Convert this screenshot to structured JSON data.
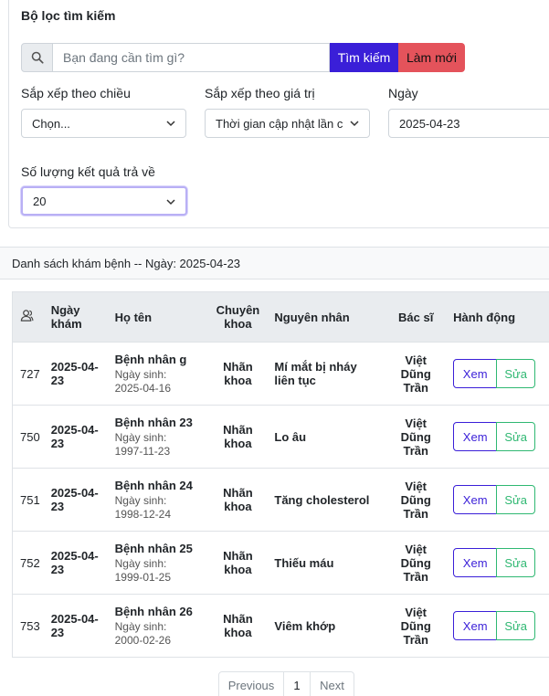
{
  "filter": {
    "title": "Bộ lọc tìm kiếm",
    "search_placeholder": "Bạn đang cần tìm gì?",
    "search_button": "Tìm kiếm",
    "reset_button": "Làm mới",
    "sort_direction_label": "Sắp xếp theo chiều",
    "sort_direction_value": "Chọn...",
    "sort_by_label": "Sắp xếp theo giá trị",
    "sort_by_value": "Thời gian cập nhật lần c",
    "date_label": "Ngày",
    "date_value": "2025-04-23",
    "result_count_label": "Số lượng kết quả trả về",
    "result_count_value": "20"
  },
  "list": {
    "header": "Danh sách khám bệnh -- Ngày: 2025-04-23",
    "columns": {
      "icon": "user-icon",
      "date": "Ngày khám",
      "name": "Họ tên",
      "specialty": "Chuyên khoa",
      "reason": "Nguyên nhân",
      "doctor": "Bác sĩ",
      "actions": "Hành động"
    },
    "dob_label": "Ngày sinh:",
    "view_label": "Xem",
    "edit_label": "Sửa",
    "rows": [
      {
        "id": "727",
        "date": "2025-04-23",
        "name": "Bệnh nhân g",
        "dob": "2025-04-16",
        "specialty": "Nhãn khoa",
        "reason": "Mí mắt bị nháy liên tục",
        "doctor": "Việt Dũng Trần"
      },
      {
        "id": "750",
        "date": "2025-04-23",
        "name": "Bệnh nhân 23",
        "dob": "1997-11-23",
        "specialty": "Nhãn khoa",
        "reason": "Lo âu",
        "doctor": "Việt Dũng Trần"
      },
      {
        "id": "751",
        "date": "2025-04-23",
        "name": "Bệnh nhân 24",
        "dob": "1998-12-24",
        "specialty": "Nhãn khoa",
        "reason": "Tăng cholesterol",
        "doctor": "Việt Dũng Trần"
      },
      {
        "id": "752",
        "date": "2025-04-23",
        "name": "Bệnh nhân 25",
        "dob": "1999-01-25",
        "specialty": "Nhãn khoa",
        "reason": "Thiếu máu",
        "doctor": "Việt Dũng Trần"
      },
      {
        "id": "753",
        "date": "2025-04-23",
        "name": "Bệnh nhân 26",
        "dob": "2000-02-26",
        "specialty": "Nhãn khoa",
        "reason": "Viêm khớp",
        "doctor": "Việt Dũng Trần"
      }
    ]
  },
  "pagination": {
    "previous": "Previous",
    "current": "1",
    "next": "Next"
  },
  "colors": {
    "primary": "#3a1fd8",
    "danger": "#e4535b",
    "success": "#2fb872"
  }
}
